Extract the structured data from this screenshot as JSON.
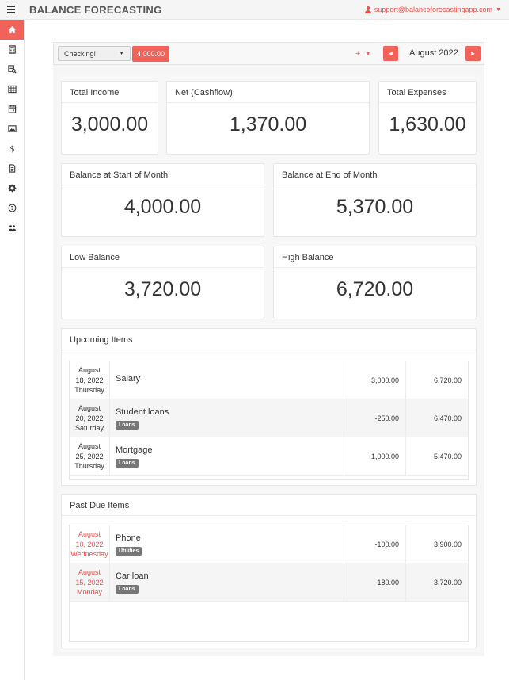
{
  "header": {
    "menu_icon": "hamburger-icon",
    "title": "BALANCE FORECASTING",
    "user_email": "support@balanceforecastingapp.com",
    "user_caret": "▼"
  },
  "sidebar": {
    "items": [
      {
        "icon": "home-icon",
        "active": true
      },
      {
        "icon": "calculator-icon",
        "active": false
      },
      {
        "icon": "search-list-icon",
        "active": false
      },
      {
        "icon": "table-icon",
        "active": false
      },
      {
        "icon": "calendar-icon",
        "active": false
      },
      {
        "icon": "image-icon",
        "active": false
      },
      {
        "icon": "dollar-icon",
        "active": false
      },
      {
        "icon": "document-icon",
        "active": false
      },
      {
        "icon": "gear-icon",
        "active": false
      },
      {
        "icon": "help-icon",
        "active": false
      },
      {
        "icon": "users-icon",
        "active": false
      }
    ]
  },
  "toolbar": {
    "account": "Checking!",
    "account_caret": "▼",
    "account_balance": "4,000.00",
    "add_symbol": "+",
    "add_caret": "▼",
    "month": "August 2022",
    "prev_symbol": "◄",
    "next_symbol": "►"
  },
  "summary": {
    "total_income_label": "Total Income",
    "total_income": "3,000.00",
    "net_label": "Net (Cashflow)",
    "net": "1,370.00",
    "total_expenses_label": "Total Expenses",
    "total_expenses": "1,630.00",
    "start_label": "Balance at Start of Month",
    "start": "4,000.00",
    "end_label": "Balance at End of Month",
    "end": "5,370.00",
    "low_label": "Low Balance",
    "low": "3,720.00",
    "high_label": "High Balance",
    "high": "6,720.00"
  },
  "upcoming": {
    "title": "Upcoming Items",
    "rows": [
      {
        "date1": "August",
        "date2": "18, 2022",
        "date3": "Thursday",
        "name": "Salary",
        "tag": "",
        "amount": "3,000.00",
        "balance": "6,720.00"
      },
      {
        "date1": "August",
        "date2": "20, 2022",
        "date3": "Saturday",
        "name": "Student loans",
        "tag": "Loans",
        "amount": "-250.00",
        "balance": "6,470.00"
      },
      {
        "date1": "August",
        "date2": "25, 2022",
        "date3": "Thursday",
        "name": "Mortgage",
        "tag": "Loans",
        "amount": "-1,000.00",
        "balance": "5,470.00"
      }
    ]
  },
  "past_due": {
    "title": "Past Due Items",
    "rows": [
      {
        "date1": "August",
        "date2": "10, 2022",
        "date3": "Wednesday",
        "name": "Phone",
        "tag": "Utilities",
        "amount": "-100.00",
        "balance": "3,900.00"
      },
      {
        "date1": "August",
        "date2": "15, 2022",
        "date3": "Monday",
        "name": "Car loan",
        "tag": "Loans",
        "amount": "-180.00",
        "balance": "3,720.00"
      }
    ]
  },
  "colors": {
    "accent": "#f0625a",
    "past_due_text": "#e4524c",
    "tag_bg": "#777777"
  }
}
